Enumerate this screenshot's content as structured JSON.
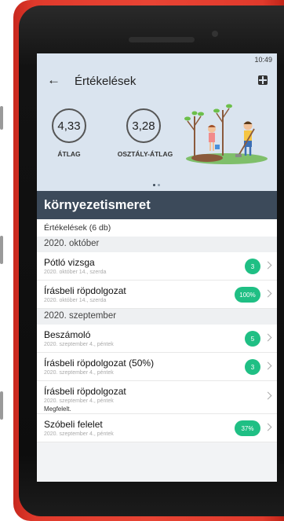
{
  "status_bar": {
    "time": "10:49"
  },
  "app_bar": {
    "title": "Értékelések",
    "back_icon": "arrow-left-icon",
    "menu_icon": "grid-menu-icon"
  },
  "averages": {
    "own": {
      "value": "4,33",
      "label": "ÁTLAG"
    },
    "class": {
      "value": "3,28",
      "label": "OSZTÁLY-ÁTLAG"
    }
  },
  "carousel": {
    "pages": 2,
    "active": 0
  },
  "subject": {
    "name": "környezetismeret"
  },
  "grades_count": "Értékelések (6 db)",
  "sections": [
    {
      "month": "2020. október",
      "items": [
        {
          "title": "Pótló vizsga",
          "date": "2020. október 14., szerda",
          "badge": "3"
        },
        {
          "title": "Írásbeli röpdolgozat",
          "date": "2020. október 14., szerda",
          "badge": "100%"
        }
      ]
    },
    {
      "month": "2020. szeptember",
      "items": [
        {
          "title": "Beszámoló",
          "date": "2020. szeptember 4., péntek",
          "badge": "5"
        },
        {
          "title": "Írásbeli röpdolgozat (50%)",
          "date": "2020. szeptember 4., péntek",
          "badge": "3"
        },
        {
          "title": "Írásbeli röpdolgozat",
          "date": "2020. szeptember 4., péntek",
          "note": "Megfelelt."
        },
        {
          "title": "Szóbeli felelet",
          "date": "2020. szeptember 4., péntek",
          "badge": "37%"
        }
      ]
    }
  ],
  "colors": {
    "header_bg": "#dae4ef",
    "subject_bar": "#3c4a5a",
    "badge": "#1fbf84",
    "phone_case": "#e84434"
  }
}
